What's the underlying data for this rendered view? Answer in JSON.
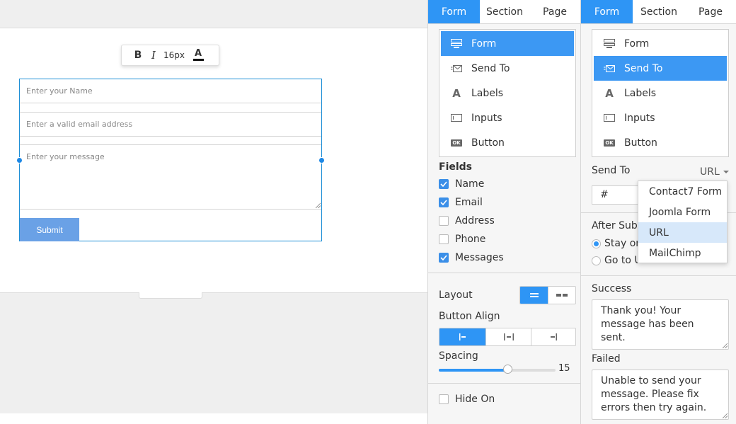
{
  "toolbar": {
    "bold": "B",
    "italic": "I",
    "size": "16px",
    "color_glyph": "A"
  },
  "form": {
    "name_placeholder": "Enter your Name",
    "email_placeholder": "Enter a valid email address",
    "message_placeholder": "Enter your message",
    "submit_label": "Submit"
  },
  "panel1": {
    "tabs": [
      "Form",
      "Section",
      "Page"
    ],
    "menu": [
      {
        "label": "Form",
        "icon": "form-icon"
      },
      {
        "label": "Send To",
        "icon": "send-to-icon"
      },
      {
        "label": "Labels",
        "icon": "labels-icon"
      },
      {
        "label": "Inputs",
        "icon": "inputs-icon"
      },
      {
        "label": "Button",
        "icon": "button-ok-icon"
      }
    ],
    "fields_title": "Fields",
    "fields": [
      {
        "label": "Name",
        "checked": true
      },
      {
        "label": "Email",
        "checked": true
      },
      {
        "label": "Address",
        "checked": false
      },
      {
        "label": "Phone",
        "checked": false
      },
      {
        "label": "Messages",
        "checked": true
      }
    ],
    "layout_label": "Layout",
    "button_align_label": "Button Align",
    "spacing_label": "Spacing",
    "spacing_value": "15",
    "hide_on_label": "Hide On"
  },
  "panel2": {
    "tabs": [
      "Form",
      "Section",
      "Page"
    ],
    "menu": [
      {
        "label": "Form",
        "icon": "form-icon"
      },
      {
        "label": "Send To",
        "icon": "send-to-icon"
      },
      {
        "label": "Labels",
        "icon": "labels-icon"
      },
      {
        "label": "Inputs",
        "icon": "inputs-icon"
      },
      {
        "label": "Button",
        "icon": "button-ok-icon"
      }
    ],
    "send_to_label": "Send To",
    "send_to_value": "URL",
    "url_value": "#",
    "after_submit_label": "After Subm",
    "radio_stay": "Stay on",
    "radio_goto": "Go to Url",
    "dropdown_options": [
      "Contact7 Form",
      "Joomla Form",
      "URL",
      "MailChimp"
    ],
    "success_label": "Success",
    "success_text": "Thank you! Your message has been sent.",
    "failed_label": "Failed",
    "failed_text": "Unable to send your message. Please fix errors then try again."
  },
  "colors": {
    "accent": "#2e95f5",
    "submit": "#6aa1e6",
    "selection_border": "#1e8fd6"
  }
}
